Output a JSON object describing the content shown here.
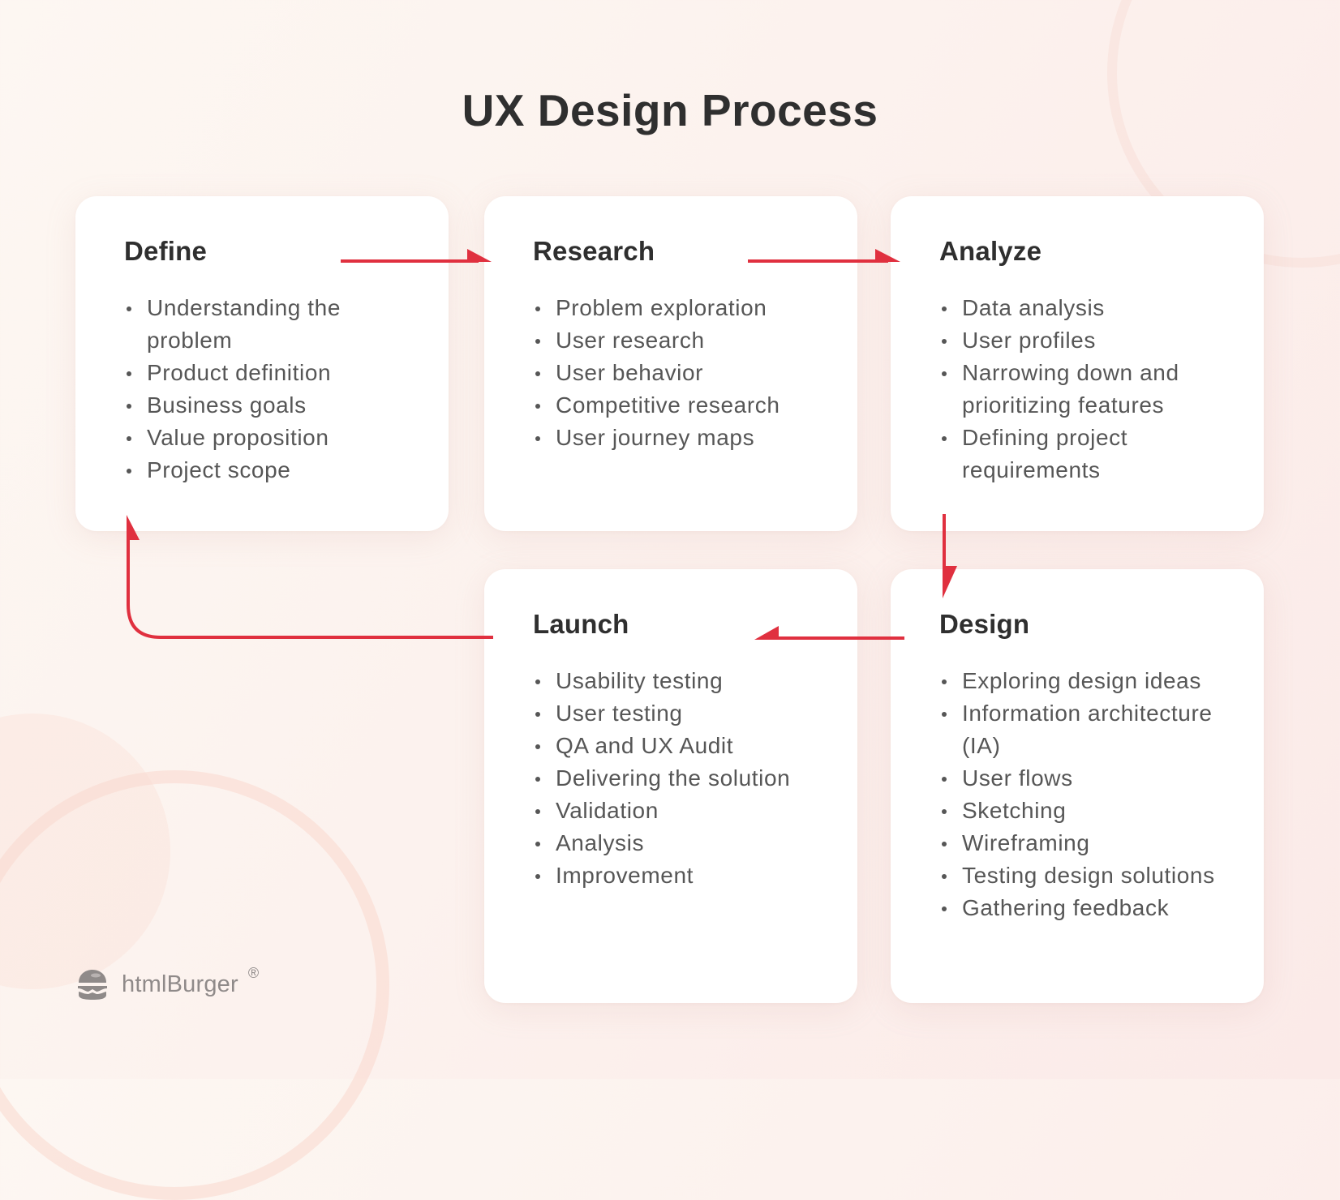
{
  "title": "UX Design Process",
  "colors": {
    "accent": "#e0303f",
    "heading": "#2f2f2f",
    "body_text": "#565656",
    "card_bg": "#ffffff",
    "brand_gray": "#8f8a89"
  },
  "steps": [
    {
      "id": "define",
      "title": "Define",
      "items": [
        "Understanding the problem",
        "Product definition",
        "Business goals",
        "Value proposition",
        "Project scope"
      ]
    },
    {
      "id": "research",
      "title": "Research",
      "items": [
        "Problem exploration",
        "User research",
        "User behavior",
        "Competitive research",
        "User journey maps"
      ]
    },
    {
      "id": "analyze",
      "title": "Analyze",
      "items": [
        "Data analysis",
        "User profiles",
        "Narrowing down and prioritizing features",
        "Defining project requirements"
      ]
    },
    {
      "id": "design",
      "title": "Design",
      "items": [
        "Exploring design ideas",
        "Information architecture (IA)",
        "User flows",
        "Sketching",
        "Wireframing",
        "Testing design solutions",
        "Gathering feedback"
      ]
    },
    {
      "id": "launch",
      "title": "Launch",
      "items": [
        "Usability testing",
        "User testing",
        "QA and UX Audit",
        "Delivering the solution",
        "Validation",
        "Analysis",
        "Improvement"
      ]
    }
  ],
  "flow": [
    {
      "from": "Define",
      "to": "Research",
      "direction": "right"
    },
    {
      "from": "Research",
      "to": "Analyze",
      "direction": "right"
    },
    {
      "from": "Analyze",
      "to": "Design",
      "direction": "down"
    },
    {
      "from": "Design",
      "to": "Launch",
      "direction": "left"
    },
    {
      "from": "Launch",
      "to": "Define",
      "direction": "up"
    }
  ],
  "brand": {
    "logo_icon": "burger-logo-icon",
    "name": "htmlBurger",
    "registered_mark": "®"
  }
}
